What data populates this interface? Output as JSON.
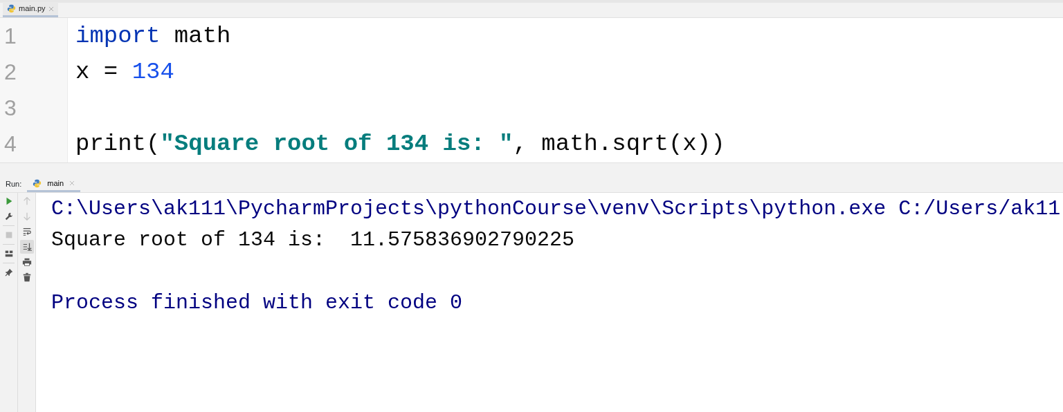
{
  "editor_tabs": [
    {
      "label": "main.py",
      "selected": true
    }
  ],
  "code_lines": [
    {
      "number": "1",
      "tokens": [
        {
          "kind": "keyword",
          "text": "import"
        },
        {
          "kind": "plain",
          "text": " math"
        }
      ]
    },
    {
      "number": "2",
      "tokens": [
        {
          "kind": "plain",
          "text": "x = "
        },
        {
          "kind": "number",
          "text": "134"
        }
      ]
    },
    {
      "number": "3"
    },
    {
      "number": "4",
      "tokens": [
        {
          "kind": "plain",
          "text": "print("
        },
        {
          "kind": "string",
          "text": "\"Square root of 134 is: \""
        },
        {
          "kind": "plain",
          "text": ", math.sqrt(x))"
        }
      ]
    }
  ],
  "run_panel": {
    "label": "Run:",
    "tabs": [
      {
        "label": "main",
        "selected": true
      }
    ],
    "left_toolbar": [
      {
        "kind": "run",
        "disabled": false
      },
      {
        "kind": "wrench",
        "disabled": false
      },
      {
        "kind": "stop",
        "disabled": true
      },
      {
        "kind": "layout",
        "disabled": false
      },
      {
        "kind": "pin",
        "disabled": false
      }
    ],
    "right_toolbar": [
      {
        "kind": "up",
        "disabled": true,
        "selected": false
      },
      {
        "kind": "down",
        "disabled": true,
        "selected": false
      },
      {
        "kind": "wrap",
        "disabled": false,
        "selected": false
      },
      {
        "kind": "scroll-end",
        "disabled": false,
        "selected": true
      },
      {
        "kind": "print",
        "disabled": false,
        "selected": false
      },
      {
        "kind": "trash",
        "disabled": false,
        "selected": false
      }
    ],
    "console_lines": [
      {
        "kind": "command",
        "text": "C:\\Users\\ak111\\PycharmProjects\\pythonCourse\\venv\\Scripts\\python.exe C:/Users/ak11"
      },
      {
        "kind": "output",
        "text": "Square root of 134 is:  11.575836902790225"
      },
      {
        "kind": "exit",
        "text": "Process finished with exit code 0"
      }
    ]
  }
}
